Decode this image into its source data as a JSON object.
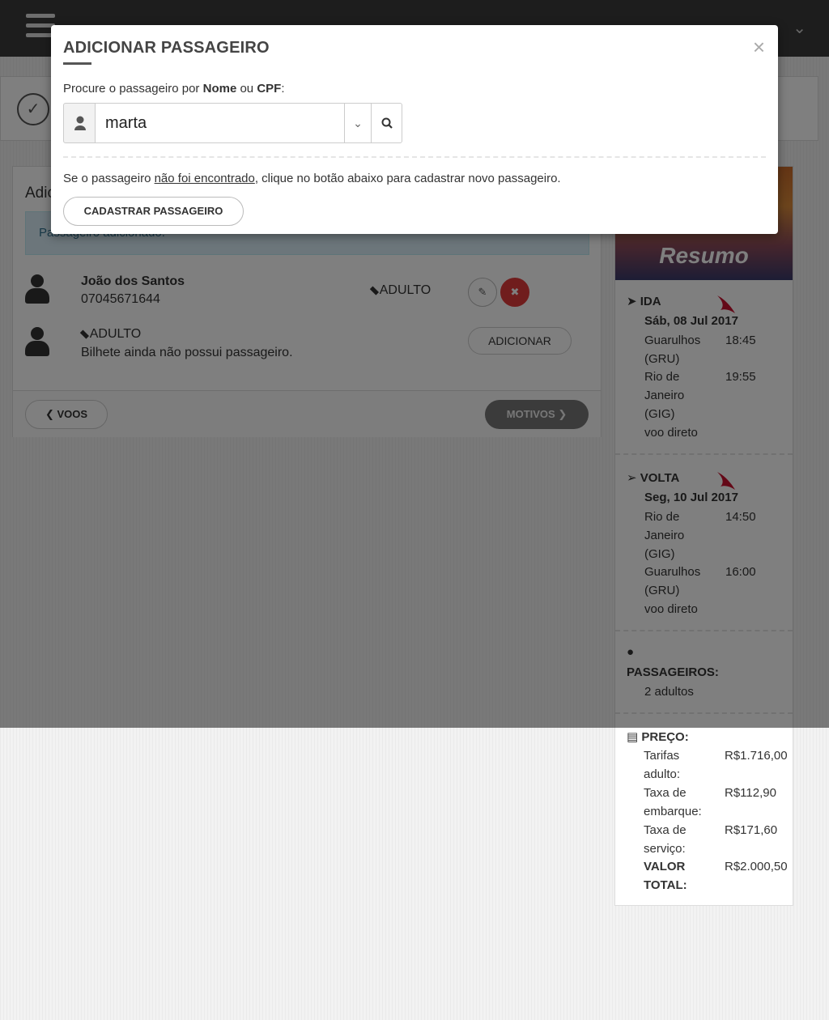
{
  "modal": {
    "title": "ADICIONAR PASSAGEIRO",
    "close": "×",
    "search_label_prefix": "Procure o passageiro por ",
    "search_label_nome": "Nome",
    "search_label_ou": " ou ",
    "search_label_cpf": "CPF",
    "search_label_colon": ":",
    "search_value": "marta",
    "not_found_prefix": "Se o passageiro ",
    "not_found_link": "não foi encontrado",
    "not_found_suffix": ", clique no botão abaixo para cadastrar novo passageiro.",
    "register_button": "CADASTRAR PASSAGEIRO"
  },
  "main": {
    "panel_title": "Adic",
    "alert": "Passageiro adicionado.",
    "passengers": [
      {
        "name": "João dos Santos",
        "cpf": "07045671644",
        "type": "ADULTO"
      }
    ],
    "empty_ticket": {
      "type": "ADULTO",
      "message": "Bilhete ainda não possui passageiro.",
      "add_button": "ADICIONAR"
    },
    "back_button": "VOOS",
    "next_button": "MOTIVOS"
  },
  "summary": {
    "title": "Resumo",
    "outbound": {
      "label": "IDA",
      "date": "Sáb, 08 Jul 2017",
      "from_city_1": "Guarulhos",
      "from_city_2": "(GRU)",
      "from_time": "18:45",
      "to_city_1": "Rio de",
      "to_city_2": "Janeiro",
      "to_city_3": "(GIG)",
      "to_time": "19:55",
      "note": "voo direto"
    },
    "inbound": {
      "label": "VOLTA",
      "date": "Seg, 10 Jul 2017",
      "from_city_1": "Rio de",
      "from_city_2": "Janeiro",
      "from_city_3": "(GIG)",
      "from_time": "14:50",
      "to_city_1": "Guarulhos",
      "to_city_2": "(GRU)",
      "to_time": "16:00",
      "note": "voo direto"
    },
    "passengers_label": "PASSAGEIROS:",
    "passengers_value": "2 adultos",
    "price_label": "PREÇO:",
    "fares_label_1": "Tarifas",
    "fares_label_2": "adulto:",
    "fares_value": "R$1.716,00",
    "boarding_label_1": "Taxa de",
    "boarding_label_2": "embarque:",
    "boarding_value": "R$112,90",
    "service_label_1": "Taxa de",
    "service_label_2": "serviço:",
    "service_value": "R$171,60",
    "total_label_1": "VALOR",
    "total_label_2": "TOTAL:",
    "total_value": "R$2.000,50"
  },
  "colors": {
    "airline_red": "#c8102e",
    "delete_red": "#e03b3b",
    "topbar": "#3a3a3a"
  }
}
